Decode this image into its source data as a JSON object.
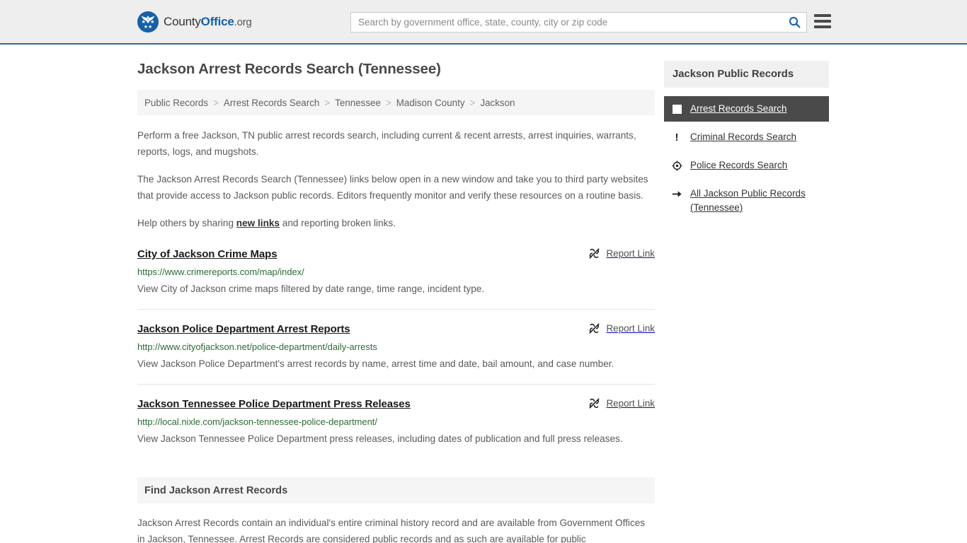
{
  "header": {
    "brand": {
      "part1": "County",
      "part2": "Office",
      "part3": ".org",
      "seal_icon": "eagle-seal-icon"
    },
    "search": {
      "placeholder": "Search by government office, state, county, city or zip code",
      "value": "",
      "search_icon": "search-icon"
    },
    "menu_icon": "hamburger-menu-icon",
    "accent_color": "#1560a8",
    "border_color": "#2d6ca2"
  },
  "main": {
    "title": "Jackson Arrest Records Search (Tennessee)",
    "breadcrumb": {
      "separator": ">",
      "items": [
        {
          "label": "Public Records"
        },
        {
          "label": "Arrest Records Search"
        },
        {
          "label": "Tennessee"
        },
        {
          "label": "Madison County"
        },
        {
          "label": "Jackson"
        }
      ]
    },
    "intro": {
      "p1": "Perform a free Jackson, TN public arrest records search, including current & recent arrests, arrest inquiries, warrants, reports, logs, and mugshots.",
      "p2": "The Jackson Arrest Records Search (Tennessee) links below open in a new window and take you to third party websites that provide access to Jackson public records. Editors frequently monitor and verify these resources on a routine basis.",
      "p3_before": "Help others by sharing ",
      "p3_link": "new links",
      "p3_after": " and reporting broken links."
    },
    "report_link_label": "Report Link",
    "report_link_icon": "broken-link-icon",
    "results": [
      {
        "title": "City of Jackson Crime Maps",
        "url": "https://www.crimereports.com/map/index/",
        "description": "View City of Jackson crime maps filtered by date range, time range, incident type."
      },
      {
        "title": "Jackson Police Department Arrest Reports",
        "url": "http://www.cityofjackson.net/police-department/daily-arrests",
        "description": "View Jackson Police Department's arrest records by name, arrest time and date, bail amount, and case number."
      },
      {
        "title": "Jackson Tennessee Police Department Press Releases",
        "url": "http://local.nixle.com/jackson-tennessee-police-department/",
        "description": "View Jackson Tennessee Police Department press releases, including dates of publication and full press releases."
      }
    ],
    "find_section": {
      "heading": "Find Jackson Arrest Records",
      "body": "Jackson Arrest Records contain an individual's entire criminal history record and are available from Government Offices in Jackson, Tennessee. Arrest Records are considered public records and as such are available for public"
    }
  },
  "sidebar": {
    "heading": "Jackson Public Records",
    "active_background": "#4a4a4a",
    "items": [
      {
        "label": "Arrest Records Search",
        "icon": "white-square-icon",
        "active": true
      },
      {
        "label": "Criminal Records Search",
        "icon": "exclamation-icon",
        "active": false
      },
      {
        "label": "Police Records Search",
        "icon": "crosshair-target-icon",
        "active": false
      },
      {
        "label": "All Jackson Public Records (Tennessee)",
        "icon": "arrow-right-icon",
        "active": false
      }
    ]
  }
}
